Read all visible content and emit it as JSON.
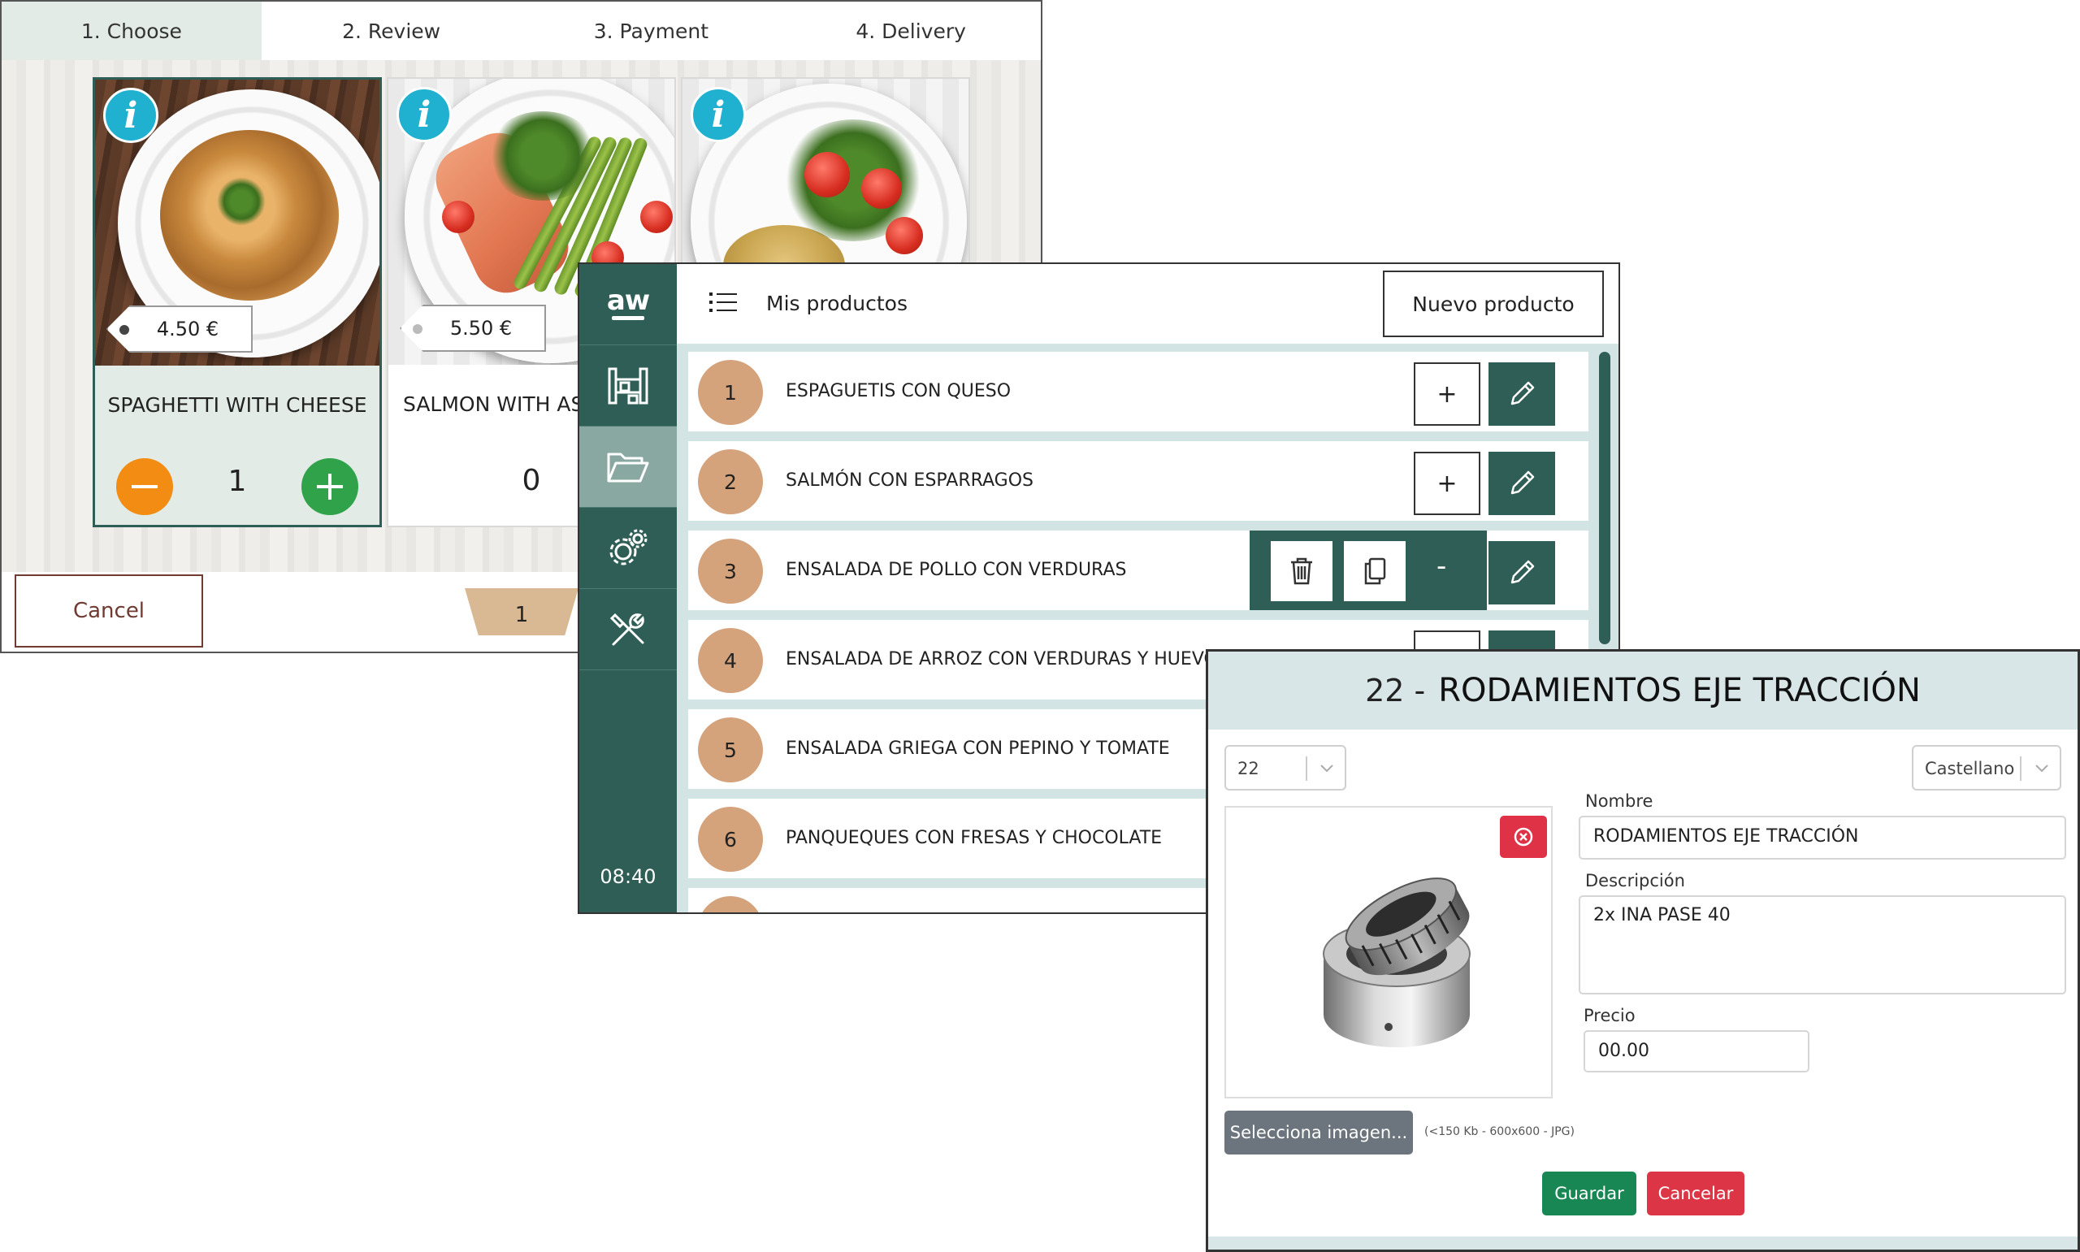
{
  "kiosk": {
    "steps": [
      "1. Choose",
      "2. Review",
      "3. Payment",
      "4. Delivery"
    ],
    "active_step": 0,
    "products": [
      {
        "name": "SPAGHETTI WITH CHEESE",
        "price": "4.50 €",
        "quantity": "1",
        "selected": true,
        "info": "i"
      },
      {
        "name": "SALMON WITH ASP",
        "price": "5.50 €",
        "quantity": "0",
        "selected": false,
        "info": "i"
      },
      {
        "name": "",
        "price": "",
        "quantity": "",
        "selected": false,
        "info": "i"
      }
    ],
    "cancel_label": "Cancel",
    "basket_count": "1"
  },
  "admin": {
    "logo": "aw",
    "time": "08:40",
    "title": "Mis productos",
    "new_product_label": "Nuevo producto",
    "plus_label": "+",
    "minus_label": "-",
    "products": [
      {
        "number": "1",
        "name": "ESPAGUETIS CON QUESO"
      },
      {
        "number": "2",
        "name": "SALMÓN CON ESPARRAGOS"
      },
      {
        "number": "3",
        "name": "ENSALADA DE POLLO CON VERDURAS"
      },
      {
        "number": "4",
        "name": "ENSALADA DE ARROZ CON VERDURAS Y HUEVO"
      },
      {
        "number": "5",
        "name": "ENSALADA GRIEGA CON PEPINO Y TOMATE"
      },
      {
        "number": "6",
        "name": "PANQUEQUES CON FRESAS Y CHOCOLATE"
      }
    ],
    "colors": {
      "primary": "#2e5e55",
      "number_badge": "#d4a27b",
      "background": "#d3e4e4"
    }
  },
  "editor": {
    "id": "22 -",
    "title": "RODAMIENTOS EJE TRACCIÓN",
    "id_select": "22",
    "language_select": "Castellano",
    "nombre_label": "Nombre",
    "nombre_value": "RODAMIENTOS EJE TRACCIÓN",
    "descripcion_label": "Descripción",
    "descripcion_value": "2x INA PASE 40",
    "precio_label": "Precio",
    "precio_value": "00.00",
    "choose_image_label": "Selecciona imagen...",
    "image_hint": "(<150 Kb - 600x600 - JPG)",
    "save_label": "Guardar",
    "cancel_label": "Cancelar",
    "colors": {
      "header": "#d8e6e8",
      "save": "#198754",
      "cancel": "#dc3545",
      "choose": "#6c757d"
    }
  }
}
